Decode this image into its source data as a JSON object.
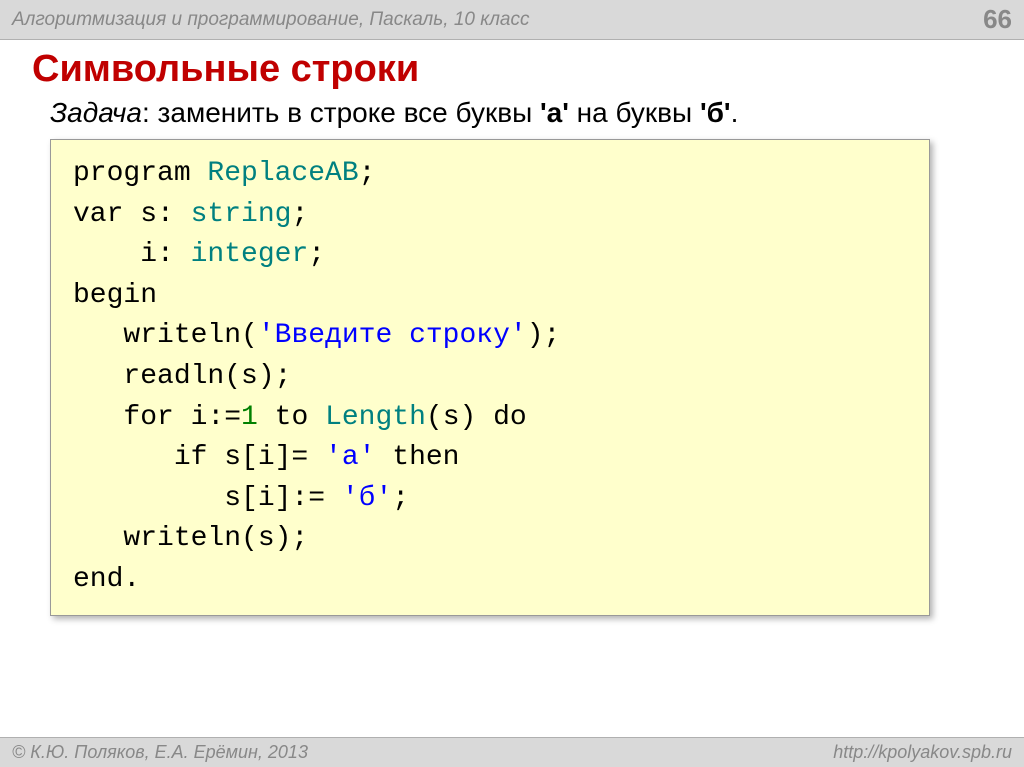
{
  "header": {
    "course": "Алгоритмизация и программирование, Паскаль, 10 класс",
    "page": "66"
  },
  "title": "Символьные строки",
  "task": {
    "label": "Задача",
    "text": ": заменить в строке все буквы ",
    "char1": "'а'",
    "mid": " на буквы ",
    "char2": "'б'",
    "end": "."
  },
  "code": {
    "l1a": "program ",
    "l1b": "ReplaceAB",
    "l1c": ";",
    "l2a": "var s: ",
    "l2b": "string",
    "l2c": ";",
    "l3a": "    i: ",
    "l3b": "integer",
    "l3c": ";",
    "l4": "begin",
    "l5a": "   writeln(",
    "l5b": "'Введите строку'",
    "l5c": ");",
    "l6": "   readln(s);",
    "l7a": "   for i:=",
    "l7b": "1",
    "l7c": " to ",
    "l7d": "Length",
    "l7e": "(s) do",
    "l8a": "      if s[i]= ",
    "l8b": "'а'",
    "l8c": " then",
    "l9a": "         s[i]:= ",
    "l9b": "'б'",
    "l9c": ";",
    "l10": "   writeln(s);",
    "l11": "end."
  },
  "footer": {
    "authors": "© К.Ю. Поляков, Е.А. Ерёмин, 2013",
    "url": "http://kpolyakov.spb.ru"
  }
}
